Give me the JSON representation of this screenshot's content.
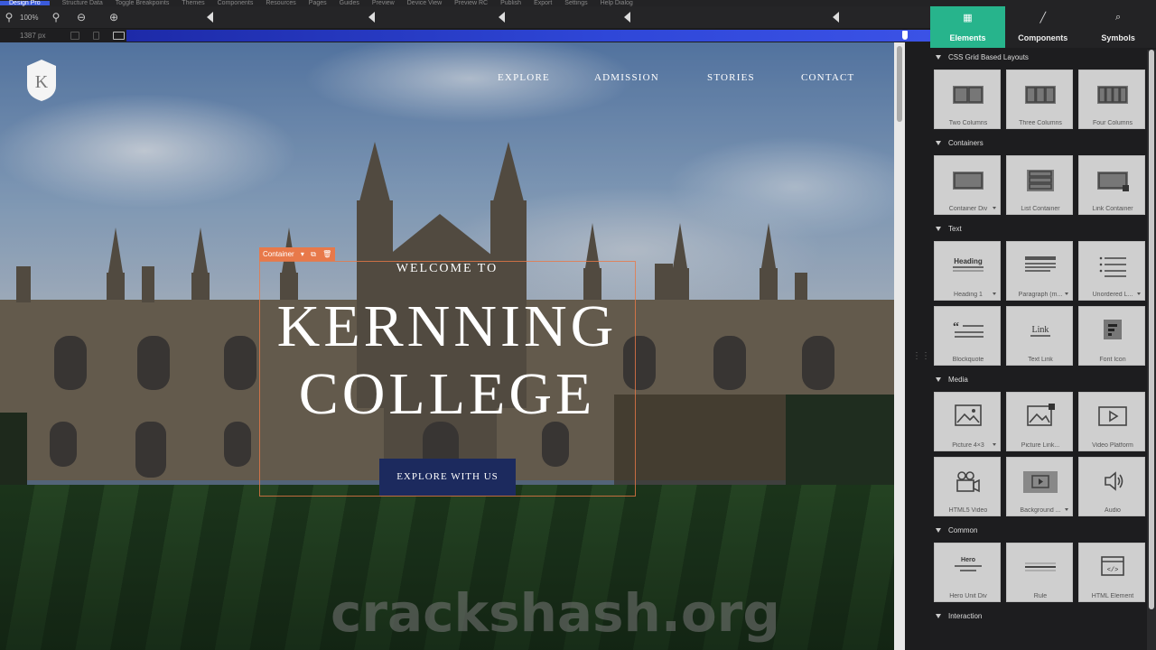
{
  "menubar": {
    "items": [
      "Design Pro",
      "Structure Data",
      "Toggle Breakpoints",
      "Themes",
      "Components",
      "Resources",
      "Pages",
      "Guides",
      "Preview",
      "Device View",
      "Preview RC",
      "Publish",
      "Export",
      "Settings",
      "Help Dialog"
    ],
    "active_index": 0
  },
  "toolbar": {
    "zoom_level": "100%",
    "icons": [
      "zoom-out-icon",
      "zoom-in-icon",
      "minus-circle-icon",
      "plus-circle-icon"
    ],
    "breakpoint_markers": 6
  },
  "ruler": {
    "width_readout": "1387 px",
    "device_icons": [
      "tablet-icon",
      "phone-icon",
      "desktop-icon"
    ]
  },
  "site": {
    "logo_letter": "K",
    "nav": [
      "EXPLORE",
      "ADMISSION",
      "STORIES",
      "CONTACT"
    ],
    "welcome": "WELCOME TO",
    "title_line1": "KERNNING",
    "title_line2": "COLLEGE",
    "cta": "EXPLORE WITH US",
    "selection_tag": "Container",
    "watermark": "crackshash.org"
  },
  "panel": {
    "tabs": [
      {
        "label": "Elements",
        "icon": "grid-icon",
        "active": true
      },
      {
        "label": "Components",
        "icon": "brush-icon",
        "active": false
      },
      {
        "label": "Symbols",
        "icon": "search-icon",
        "active": false
      }
    ],
    "categories": [
      {
        "title": "CSS Grid Based Layouts",
        "tiles": [
          {
            "label": "Two Columns",
            "icon": "two-columns-icon",
            "dropdown": false
          },
          {
            "label": "Three Columns",
            "icon": "three-columns-icon",
            "dropdown": false
          },
          {
            "label": "Four Columns",
            "icon": "four-columns-icon",
            "dropdown": false
          }
        ]
      },
      {
        "title": "Containers",
        "tiles": [
          {
            "label": "Container Div",
            "icon": "container-icon",
            "dropdown": true
          },
          {
            "label": "List Container",
            "icon": "list-container-icon",
            "dropdown": false
          },
          {
            "label": "Link Container",
            "icon": "link-container-icon",
            "dropdown": false
          }
        ]
      },
      {
        "title": "Text",
        "tiles": [
          {
            "label": "Heading 1",
            "icon": "heading-icon",
            "dropdown": true
          },
          {
            "label": "Paragraph (m...",
            "icon": "paragraph-icon",
            "dropdown": true
          },
          {
            "label": "Unordered L...",
            "icon": "unordered-list-icon",
            "dropdown": true
          },
          {
            "label": "Blockquote",
            "icon": "blockquote-icon",
            "dropdown": false
          },
          {
            "label": "Text Link",
            "icon": "text-link-icon",
            "dropdown": false
          },
          {
            "label": "Font Icon",
            "icon": "font-icon",
            "dropdown": false
          }
        ]
      },
      {
        "title": "Media",
        "tiles": [
          {
            "label": "Picture 4×3",
            "icon": "picture-icon",
            "dropdown": true
          },
          {
            "label": "Picture Link...",
            "icon": "picture-link-icon",
            "dropdown": false
          },
          {
            "label": "Video Platform",
            "icon": "video-platform-icon",
            "dropdown": false
          },
          {
            "label": "HTML5 Video",
            "icon": "html5-video-icon",
            "dropdown": false
          },
          {
            "label": "Background ...",
            "icon": "background-video-icon",
            "dropdown": true
          },
          {
            "label": "Audio",
            "icon": "audio-icon",
            "dropdown": false
          }
        ]
      },
      {
        "title": "Common",
        "tiles": [
          {
            "label": "Hero Unit Div",
            "icon": "hero-unit-icon",
            "dropdown": false
          },
          {
            "label": "Rule",
            "icon": "rule-icon",
            "dropdown": false
          },
          {
            "label": "HTML Element",
            "icon": "html-element-icon",
            "dropdown": false
          }
        ]
      },
      {
        "title": "Interaction",
        "tiles": []
      }
    ]
  },
  "colors": {
    "accent_tab": "#27b48c",
    "cta_bg": "#1c2a5e",
    "selection": "#e8794a",
    "breakpoint_bar": "#2f47d8"
  }
}
